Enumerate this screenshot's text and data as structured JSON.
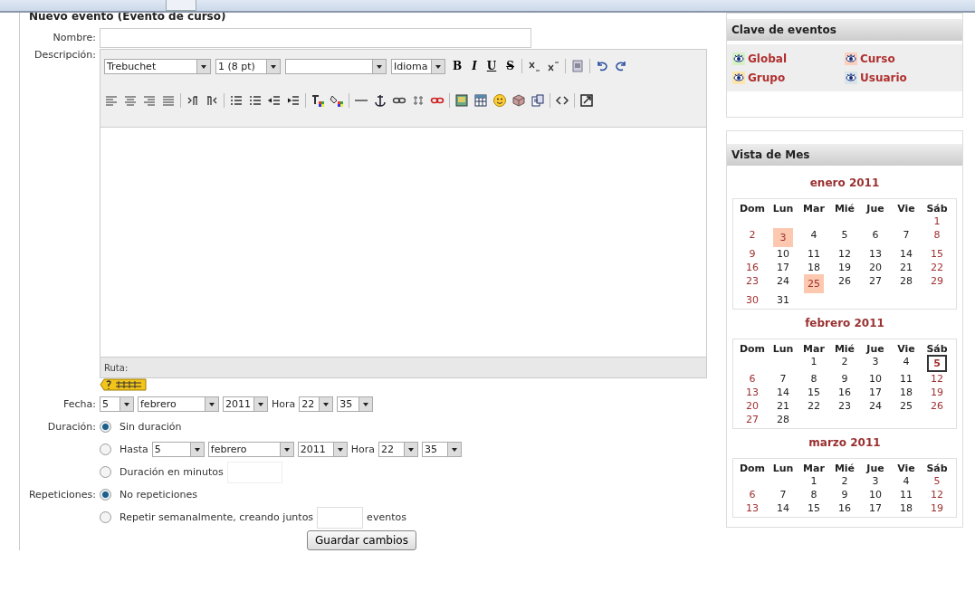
{
  "form": {
    "title": "Nuevo evento (Evento de curso)",
    "name_label": "Nombre:",
    "description_label": "Descripción:",
    "editor": {
      "font_select": "Trebuchet",
      "size_select": "1 (8 pt)",
      "language_select": "Idioma",
      "format_buttons": [
        {
          "label": "B",
          "kind": "bold"
        },
        {
          "label": "I",
          "kind": "italic"
        },
        {
          "label": "U",
          "kind": "underline"
        },
        {
          "label": "S",
          "kind": "strike"
        }
      ],
      "path_label": "Ruta:"
    },
    "date_label": "Fecha:",
    "date": {
      "day": "5",
      "month": "febrero",
      "year": "2011",
      "hour_label": "Hora",
      "hour": "22",
      "minute": "35"
    },
    "duration_label": "Duración:",
    "duration_options": [
      {
        "kind": "none",
        "label": "Sin duración",
        "selected": true
      },
      {
        "kind": "until",
        "label": "Hasta",
        "selected": false,
        "day": "5",
        "month": "febrero",
        "year": "2011",
        "hour_label": "Hora",
        "hour": "22",
        "minute": "35"
      },
      {
        "kind": "minutes",
        "label": "Duración en minutos",
        "selected": false
      }
    ],
    "repeat_label": "Repeticiones:",
    "repeat_options": [
      {
        "kind": "none",
        "label": "No repeticiones",
        "selected": true
      },
      {
        "kind": "weekly",
        "label": "Repetir semanalmente, creando juntos",
        "after": "eventos",
        "selected": false
      }
    ],
    "save_button": "Guardar cambios"
  },
  "sidebar": {
    "key": {
      "title": "Clave de eventos",
      "items": [
        {
          "label": "Global",
          "color": "#d4f2c4"
        },
        {
          "label": "Curso",
          "color": "#fdd0bd"
        },
        {
          "label": "Grupo",
          "color": "#fde6ad"
        },
        {
          "label": "Usuario",
          "color": "#d9e4ea"
        }
      ]
    },
    "month_view": {
      "title": "Vista de Mes",
      "months": [
        {
          "title": "enero 2011",
          "weekdays": [
            "Dom",
            "Lun",
            "Mar",
            "Mié",
            "Jue",
            "Vie",
            "Sáb"
          ],
          "weeks": [
            [
              {
                "n": "1",
                "kind": "plain"
              }
            ],
            [
              {
                "n": "2",
                "kind": "plain"
              },
              {
                "n": "3",
                "kind": "event"
              },
              {
                "n": "4",
                "kind": "plain"
              },
              {
                "n": "5",
                "kind": "plain"
              },
              {
                "n": "6",
                "kind": "plain"
              },
              {
                "n": "7",
                "kind": "plain"
              },
              {
                "n": "8",
                "kind": "plain"
              }
            ],
            [
              {
                "n": "9",
                "kind": "plain"
              },
              {
                "n": "10",
                "kind": "plain"
              },
              {
                "n": "11",
                "kind": "plain"
              },
              {
                "n": "12",
                "kind": "plain"
              },
              {
                "n": "13",
                "kind": "plain"
              },
              {
                "n": "14",
                "kind": "plain"
              },
              {
                "n": "15",
                "kind": "plain"
              }
            ],
            [
              {
                "n": "16",
                "kind": "plain"
              },
              {
                "n": "17",
                "kind": "plain"
              },
              {
                "n": "18",
                "kind": "plain"
              },
              {
                "n": "19",
                "kind": "plain"
              },
              {
                "n": "20",
                "kind": "plain"
              },
              {
                "n": "21",
                "kind": "plain"
              },
              {
                "n": "22",
                "kind": "plain"
              }
            ],
            [
              {
                "n": "23",
                "kind": "plain"
              },
              {
                "n": "24",
                "kind": "plain"
              },
              {
                "n": "25",
                "kind": "event"
              },
              {
                "n": "26",
                "kind": "plain"
              },
              {
                "n": "27",
                "kind": "plain"
              },
              {
                "n": "28",
                "kind": "plain"
              },
              {
                "n": "29",
                "kind": "plain"
              }
            ],
            [
              {
                "n": "30",
                "kind": "plain"
              },
              {
                "n": "31",
                "kind": "plain"
              }
            ]
          ]
        },
        {
          "title": "febrero 2011",
          "weekdays": [
            "Dom",
            "Lun",
            "Mar",
            "Mié",
            "Jue",
            "Vie",
            "Sáb"
          ],
          "weeks": [
            [
              {
                "n": "1",
                "kind": "plain"
              },
              {
                "n": "2",
                "kind": "plain"
              },
              {
                "n": "3",
                "kind": "plain"
              },
              {
                "n": "4",
                "kind": "plain"
              },
              {
                "n": "5",
                "kind": "today"
              }
            ],
            [
              {
                "n": "6",
                "kind": "plain"
              },
              {
                "n": "7",
                "kind": "plain"
              },
              {
                "n": "8",
                "kind": "plain"
              },
              {
                "n": "9",
                "kind": "plain"
              },
              {
                "n": "10",
                "kind": "plain"
              },
              {
                "n": "11",
                "kind": "plain"
              },
              {
                "n": "12",
                "kind": "plain"
              }
            ],
            [
              {
                "n": "13",
                "kind": "plain"
              },
              {
                "n": "14",
                "kind": "plain"
              },
              {
                "n": "15",
                "kind": "plain"
              },
              {
                "n": "16",
                "kind": "plain"
              },
              {
                "n": "17",
                "kind": "plain"
              },
              {
                "n": "18",
                "kind": "plain"
              },
              {
                "n": "19",
                "kind": "plain"
              }
            ],
            [
              {
                "n": "20",
                "kind": "plain"
              },
              {
                "n": "21",
                "kind": "plain"
              },
              {
                "n": "22",
                "kind": "plain"
              },
              {
                "n": "23",
                "kind": "plain"
              },
              {
                "n": "24",
                "kind": "plain"
              },
              {
                "n": "25",
                "kind": "plain"
              },
              {
                "n": "26",
                "kind": "plain"
              }
            ],
            [
              {
                "n": "27",
                "kind": "plain"
              },
              {
                "n": "28",
                "kind": "plain"
              }
            ]
          ]
        },
        {
          "title": "marzo 2011",
          "weekdays": [
            "Dom",
            "Lun",
            "Mar",
            "Mié",
            "Jue",
            "Vie",
            "Sáb"
          ],
          "weeks": [
            [
              {
                "n": "1",
                "kind": "plain"
              },
              {
                "n": "2",
                "kind": "plain"
              },
              {
                "n": "3",
                "kind": "plain"
              },
              {
                "n": "4",
                "kind": "plain"
              },
              {
                "n": "5",
                "kind": "plain"
              }
            ],
            [
              {
                "n": "6",
                "kind": "plain"
              },
              {
                "n": "7",
                "kind": "plain"
              },
              {
                "n": "8",
                "kind": "plain"
              },
              {
                "n": "9",
                "kind": "plain"
              },
              {
                "n": "10",
                "kind": "plain"
              },
              {
                "n": "11",
                "kind": "plain"
              },
              {
                "n": "12",
                "kind": "plain"
              }
            ],
            [
              {
                "n": "13",
                "kind": "plain"
              },
              {
                "n": "14",
                "kind": "plain"
              },
              {
                "n": "15",
                "kind": "plain"
              },
              {
                "n": "16",
                "kind": "plain"
              },
              {
                "n": "17",
                "kind": "plain"
              },
              {
                "n": "18",
                "kind": "plain"
              },
              {
                "n": "19",
                "kind": "plain"
              }
            ]
          ]
        }
      ]
    }
  }
}
